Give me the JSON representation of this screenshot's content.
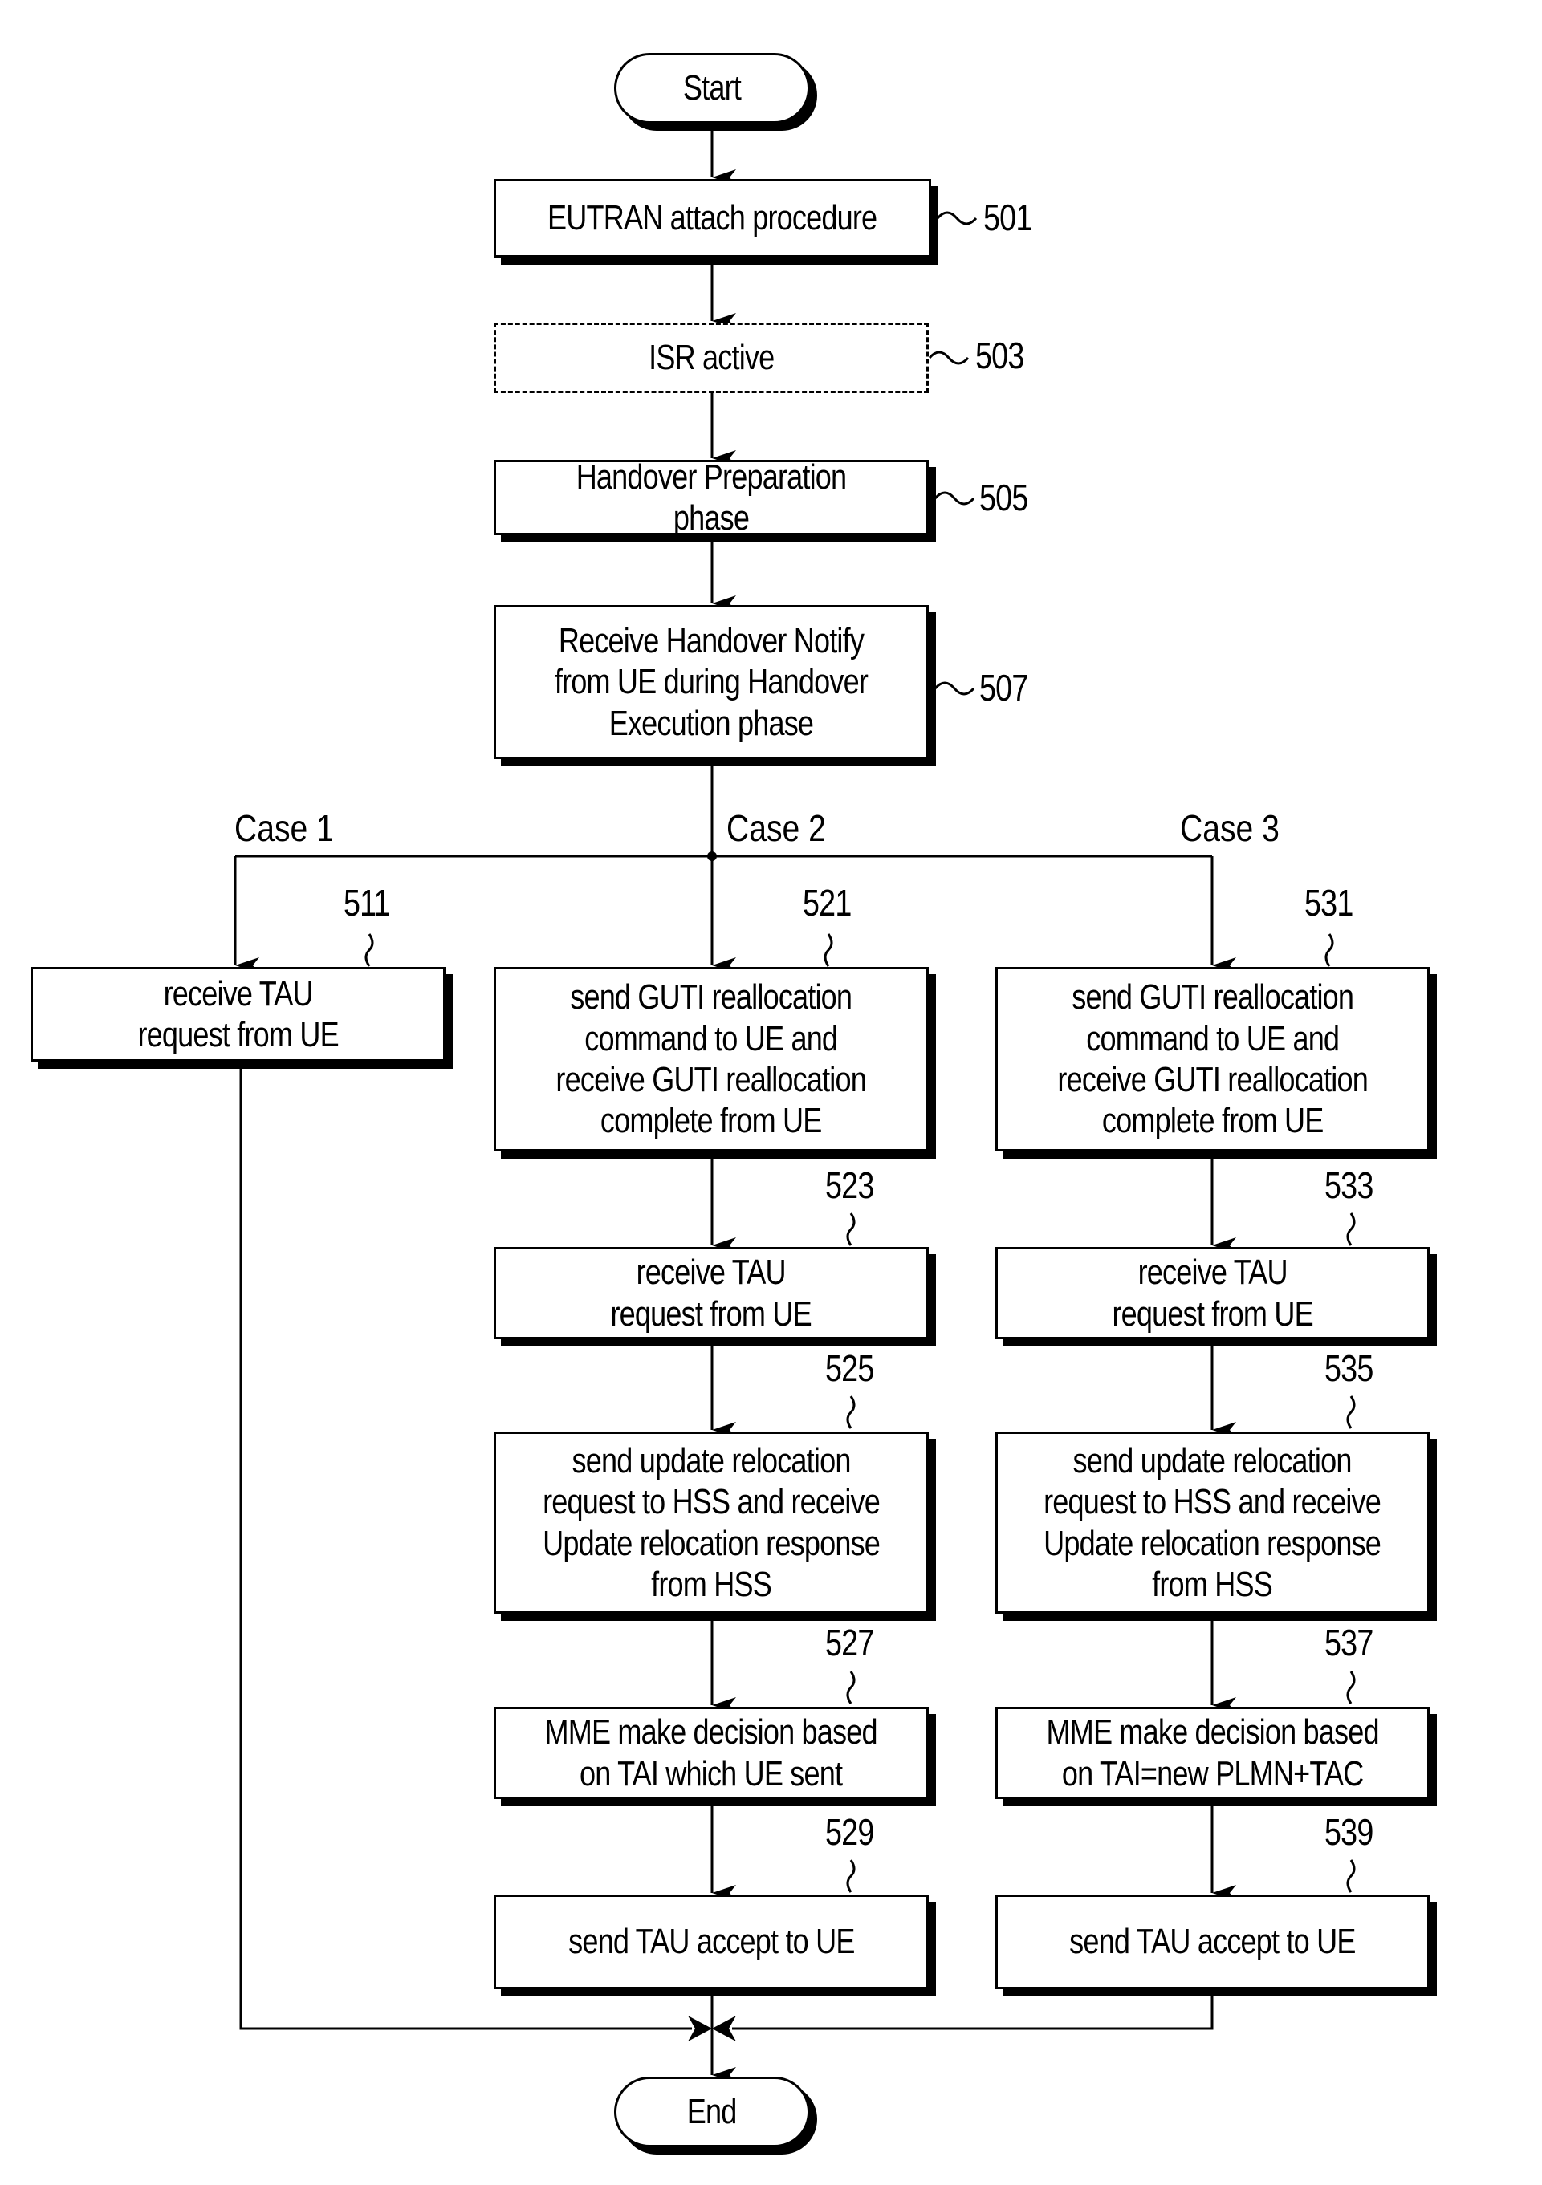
{
  "terminals": {
    "start": "Start",
    "end": "End"
  },
  "steps": {
    "s501": {
      "ref": "501",
      "text": "EUTRAN attach procedure"
    },
    "s503": {
      "ref": "503",
      "text": "ISR active",
      "style": "dashed"
    },
    "s505": {
      "ref": "505",
      "text": "Handover Preparation phase"
    },
    "s507": {
      "ref": "507",
      "text": "Receive Handover Notify\nfrom UE during Handover\nExecution phase"
    }
  },
  "cases": {
    "case1": {
      "label": "Case 1",
      "steps": [
        {
          "ref": "511",
          "text": "receive TAU\nrequest from UE"
        }
      ]
    },
    "case2": {
      "label": "Case 2",
      "steps": [
        {
          "ref": "521",
          "text": "send GUTI reallocation\ncommand to UE and\nreceive GUTI reallocation\ncomplete from UE"
        },
        {
          "ref": "523",
          "text": "receive TAU\nrequest from UE"
        },
        {
          "ref": "525",
          "text": "send update relocation\nrequest to HSS and receive\nUpdate relocation response\nfrom HSS"
        },
        {
          "ref": "527",
          "text": "MME make decision based\non TAI which UE sent"
        },
        {
          "ref": "529",
          "text": "send TAU accept to UE"
        }
      ]
    },
    "case3": {
      "label": "Case 3",
      "steps": [
        {
          "ref": "531",
          "text": "send GUTI reallocation\ncommand to UE and\nreceive GUTI reallocation\ncomplete from UE"
        },
        {
          "ref": "533",
          "text": "receive TAU\nrequest from UE"
        },
        {
          "ref": "535",
          "text": "send update relocation\nrequest to HSS and receive\nUpdate relocation response\nfrom HSS"
        },
        {
          "ref": "537",
          "text": "MME make decision based\non TAI=new PLMN+TAC"
        },
        {
          "ref": "539",
          "text": "send TAU accept to UE"
        }
      ]
    }
  }
}
